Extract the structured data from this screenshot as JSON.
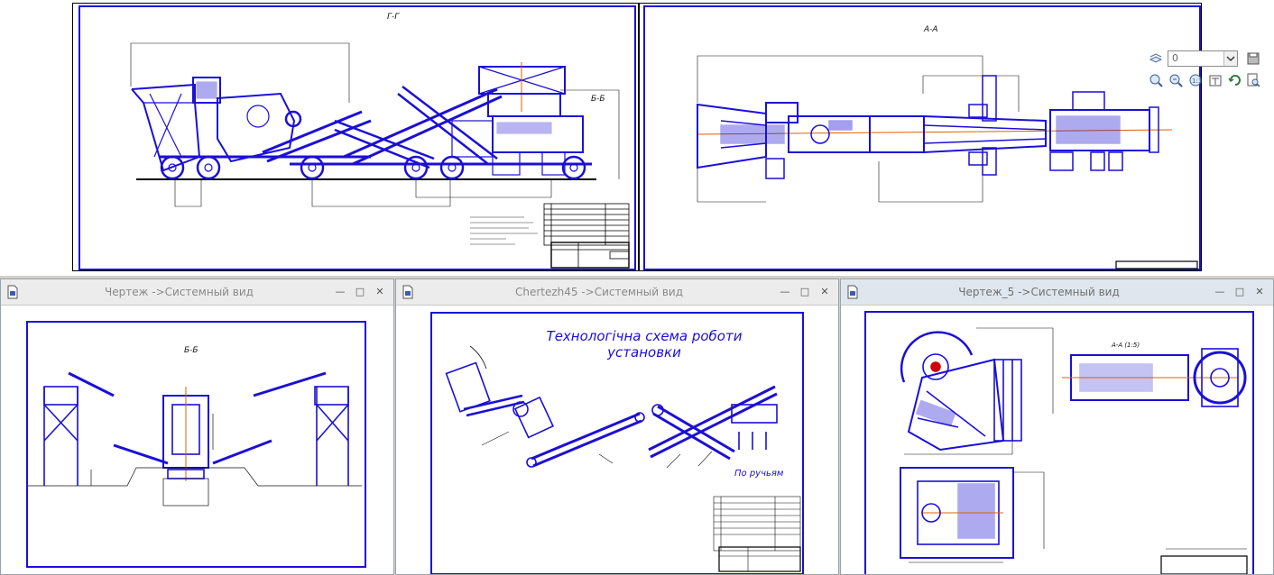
{
  "windows": [
    {
      "caption": "Чертеж ->Системный вид",
      "active": false
    },
    {
      "caption": "Chertezh45 ->Системный вид",
      "active": false
    },
    {
      "caption": "Чертеж_5 ->Системный вид",
      "active": true
    }
  ],
  "toolbar": {
    "layer_value": "0",
    "icons": [
      "layers-icon",
      "save-icon",
      "zoom-in-icon",
      "zoom-fit-icon",
      "zoom-1to1-icon",
      "properties-icon",
      "refresh-icon",
      "print-preview-icon"
    ]
  },
  "top_sheets": {
    "left_view_label": "Г-Г",
    "right_view_label": "А-А",
    "left_callout": "Б-Б"
  },
  "drawing1": {
    "view_label": "Б-Б"
  },
  "drawing2": {
    "title_line1": "Технологічна схема роботи",
    "title_line2": "установки",
    "note": "По ручьям"
  },
  "drawing3": {
    "view_label": "А-А (1:5)"
  },
  "colors": {
    "drawing_blue": "#1b0fd6",
    "accent_orange": "#e06000",
    "red": "#d00000"
  }
}
